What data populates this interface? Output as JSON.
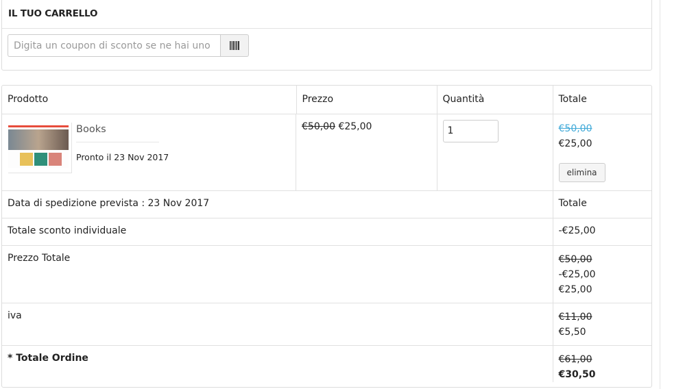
{
  "cart": {
    "title": "IL TUO CARRELLO",
    "coupon_placeholder": "Digita un coupon di sconto se ne hai uno",
    "coupon_button_icon": "barcode-icon"
  },
  "table": {
    "headers": {
      "product": "Prodotto",
      "price": "Prezzo",
      "quantity": "Quantità",
      "total": "Totale"
    },
    "item": {
      "name": "Books",
      "ready": "Pronto il 23 Nov 2017",
      "price_old": "€50,00",
      "price_new": "€25,00",
      "quantity": "1",
      "total_old": "€50,00",
      "total_new": "€25,00",
      "delete_label": "elimina"
    },
    "shipping": {
      "label": "Data di spedizione prevista : 23 Nov 2017",
      "value": "Totale"
    },
    "discount": {
      "label": "Totale sconto individuale",
      "value": "-€25,00"
    },
    "price_total": {
      "label": "Prezzo Totale",
      "old": "€50,00",
      "discount": "-€25,00",
      "new": "€25,00"
    },
    "vat": {
      "label": "iva",
      "old": "€11,00",
      "new": "€5,50"
    },
    "order_total": {
      "label": "* Totale Ordine",
      "old": "€61,00",
      "new": "€30,50"
    }
  },
  "colors": {
    "accent_strike": "#3fa9d8",
    "border": "#dcdcdc"
  }
}
